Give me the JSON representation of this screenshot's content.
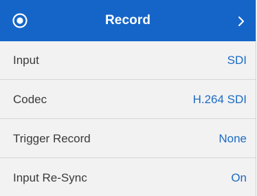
{
  "header": {
    "title": "Record",
    "icons": {
      "leading": "record-icon",
      "trailing": "chevron-right-icon"
    }
  },
  "settings": [
    {
      "label": "Input",
      "value": "SDI"
    },
    {
      "label": "Codec",
      "value": "H.264 SDI"
    },
    {
      "label": "Trigger Record",
      "value": "None"
    },
    {
      "label": "Input Re-Sync",
      "value": "On"
    }
  ],
  "colors": {
    "header_background": "#1565c8",
    "header_text": "#ffffff",
    "row_background": "#f2f2f2",
    "label_text": "#3a3a3a",
    "value_text": "#1a6bc4",
    "divider": "#d6d6d6"
  }
}
